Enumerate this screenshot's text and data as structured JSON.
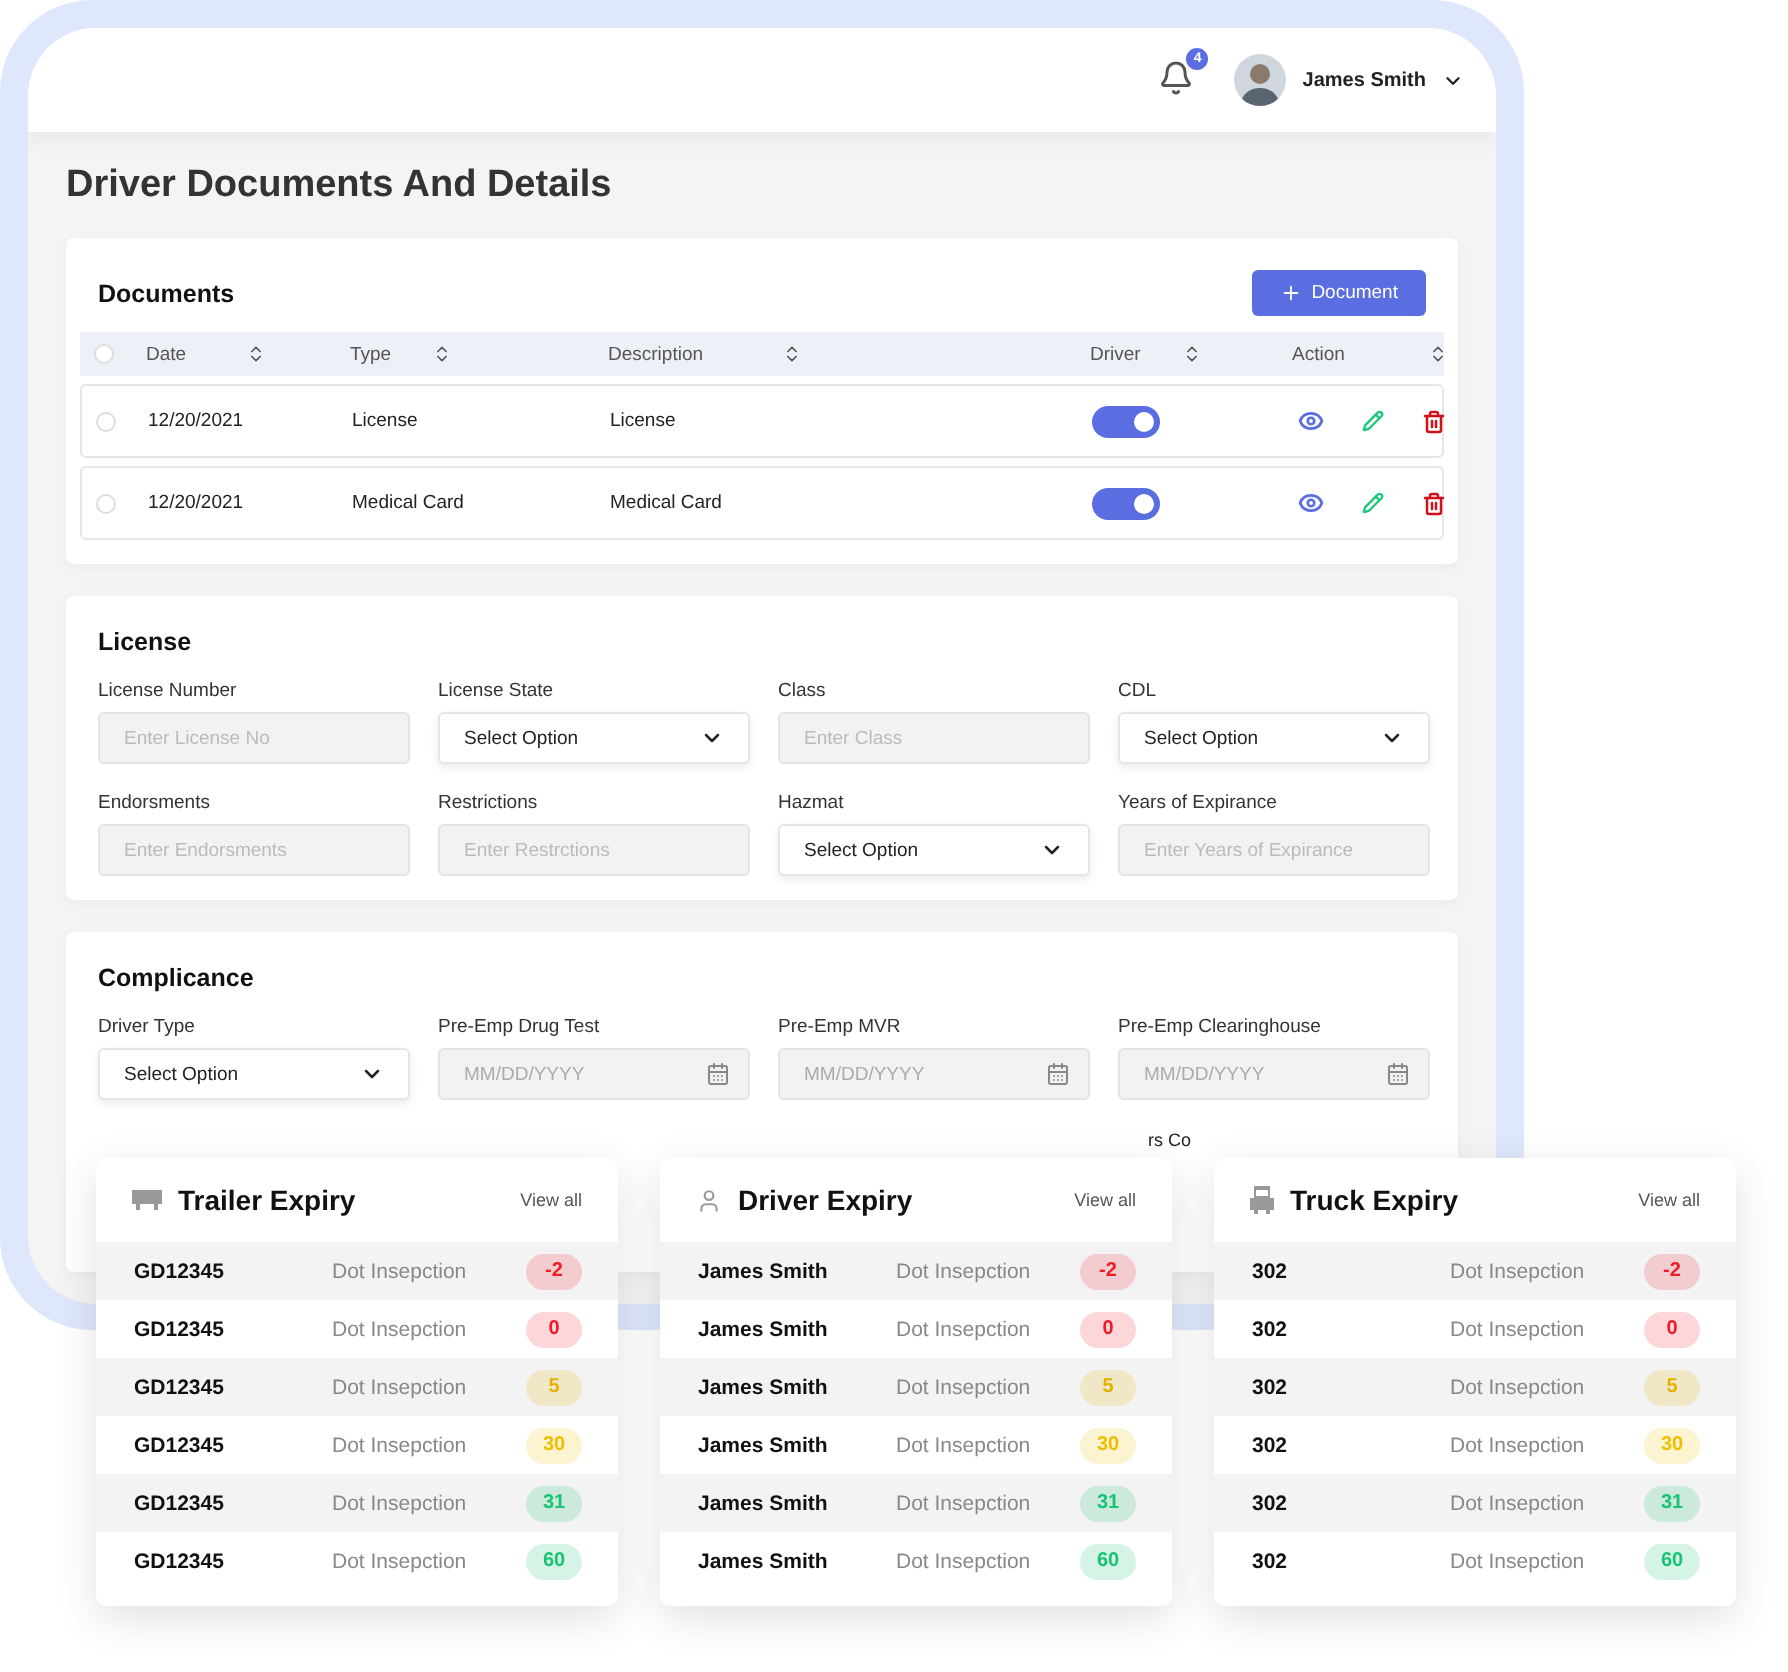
{
  "header": {
    "notifications": "4",
    "user_name": "James Smith"
  },
  "page_title": "Driver Documents And Details",
  "documents": {
    "title": "Documents",
    "add_button": "Document",
    "all_selected": false,
    "columns": [
      "Date",
      "Type",
      "Description",
      "Driver",
      "Action"
    ],
    "rows": [
      {
        "selected": false,
        "date": "12/20/2021",
        "type": "License",
        "description": "License",
        "driver_on": true
      },
      {
        "selected": false,
        "date": "12/20/2021",
        "type": "Medical Card",
        "description": "Medical Card",
        "driver_on": true
      }
    ]
  },
  "license": {
    "title": "License",
    "fields": [
      {
        "label": "License Number",
        "kind": "input",
        "placeholder": "Enter License No"
      },
      {
        "label": "License State",
        "kind": "select",
        "value": "Select Option"
      },
      {
        "label": "Class",
        "kind": "input",
        "placeholder": "Enter Class"
      },
      {
        "label": "CDL",
        "kind": "select",
        "value": "Select Option"
      },
      {
        "label": "Endorsments",
        "kind": "input",
        "placeholder": "Enter Endorsments"
      },
      {
        "label": "Restrictions",
        "kind": "input",
        "placeholder": "Enter Restrctions"
      },
      {
        "label": "Hazmat",
        "kind": "select",
        "value": "Select Option"
      },
      {
        "label": "Years of Expirance",
        "kind": "input",
        "placeholder": "Enter Years of Expirance"
      }
    ]
  },
  "compliance": {
    "title": "Complicance",
    "fields": [
      {
        "label": "Driver Type",
        "kind": "select",
        "value": "Select Option"
      },
      {
        "label": "Pre-Emp Drug Test",
        "kind": "date",
        "placeholder": "MM/DD/YYYY"
      },
      {
        "label": "Pre-Emp MVR",
        "kind": "date",
        "placeholder": "MM/DD/YYYY"
      },
      {
        "label": "Pre-Emp Clearinghouse",
        "kind": "date",
        "placeholder": "MM/DD/YYYY"
      }
    ],
    "hidden_label": "rs Co"
  },
  "expiry_cards": [
    {
      "title": "Trailer Expiry",
      "view_all": "View all",
      "rows": [
        {
          "name": "GD12345",
          "item": "Dot Insepction",
          "days": "-2",
          "color": "#ee1c25"
        },
        {
          "name": "GD12345",
          "item": "Dot Insepction",
          "days": "0",
          "color": "#ee1c25"
        },
        {
          "name": "GD12345",
          "item": "Dot Insepction",
          "days": "5",
          "color": "#e2b200"
        },
        {
          "name": "GD12345",
          "item": "Dot Insepction",
          "days": "30",
          "color": "#eebf00"
        },
        {
          "name": "GD12345",
          "item": "Dot Insepction",
          "days": "31",
          "color": "#18c472"
        },
        {
          "name": "GD12345",
          "item": "Dot Insepction",
          "days": "60",
          "color": "#18c472"
        }
      ]
    },
    {
      "title": "Driver Expiry",
      "view_all": "View all",
      "rows": [
        {
          "name": "James Smith",
          "item": "Dot Insepction",
          "days": "-2",
          "color": "#ee1c25"
        },
        {
          "name": "James Smith",
          "item": "Dot Insepction",
          "days": "0",
          "color": "#ee1c25"
        },
        {
          "name": "James Smith",
          "item": "Dot Insepction",
          "days": "5",
          "color": "#e2b200"
        },
        {
          "name": "James Smith",
          "item": "Dot Insepction",
          "days": "30",
          "color": "#eebf00"
        },
        {
          "name": "James Smith",
          "item": "Dot Insepction",
          "days": "31",
          "color": "#18c472"
        },
        {
          "name": "James Smith",
          "item": "Dot Insepction",
          "days": "60",
          "color": "#18c472"
        }
      ]
    },
    {
      "title": "Truck Expiry",
      "view_all": "View all",
      "rows": [
        {
          "name": "302",
          "item": "Dot Insepction",
          "days": "-2",
          "color": "#ee1c25"
        },
        {
          "name": "302",
          "item": "Dot Insepction",
          "days": "0",
          "color": "#ee1c25"
        },
        {
          "name": "302",
          "item": "Dot Insepction",
          "days": "5",
          "color": "#e2b200"
        },
        {
          "name": "302",
          "item": "Dot Insepction",
          "days": "30",
          "color": "#eebf00"
        },
        {
          "name": "302",
          "item": "Dot Insepction",
          "days": "31",
          "color": "#18c472"
        },
        {
          "name": "302",
          "item": "Dot Insepction",
          "days": "60",
          "color": "#18c472"
        }
      ]
    }
  ]
}
